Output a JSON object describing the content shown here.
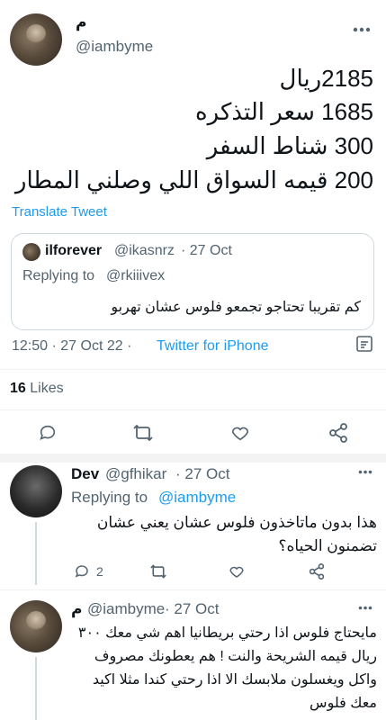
{
  "main_tweet": {
    "author_name": "م",
    "handle": "@iambyme",
    "lines": [
      "2185ريال",
      "1685 سعر التذكره",
      "300 شناط السفر",
      "200 قيمه السواق اللي وصلني المطار"
    ],
    "translate_label": "Translate Tweet",
    "quoted": {
      "name": "ilforever",
      "handle": "@ikasnrz",
      "date": "· 27 Oct",
      "replying_label": "Replying to",
      "replying_handle": "@rkiiivex",
      "text": "كم تقريبا تحتاجو تجمعو فلوس عشان تهربو"
    },
    "timestamp": "12:50 · 27 Oct 22 ·",
    "source": "Twitter for iPhone",
    "likes_count": "16",
    "likes_label": "Likes"
  },
  "replies": [
    {
      "name": "Dev",
      "handle": "@gfhikar",
      "date": "· 27 Oct",
      "replying_label": "Replying to",
      "replying_handle": "@iambyme",
      "text_lines": [
        "هذا بدون ماتاخذون فلوس عشان يعني عشان",
        "تضمنون الحياه؟"
      ],
      "reply_count": "2"
    },
    {
      "name": "م",
      "handle": "@iambyme",
      "date": "· 27 Oct",
      "text_lines": [
        "مايحتاج فلوس اذا رحتي بريطانيا اهم شي معك ٣٠٠",
        "ريال قيمه الشريحة والنت ! هم يعطونك مصروف",
        "واكل ويغسلون ملابسك الا اذا رحتي كندا مثلا اكيد",
        "معك فلوس"
      ]
    }
  ],
  "icons": {
    "reply": "reply-icon",
    "retweet": "retweet-icon",
    "like": "heart-icon",
    "share": "share-icon",
    "more": "more-icon",
    "analytics": "analytics-icon"
  },
  "colors": {
    "accent": "#1d9bf0",
    "secondary_text": "#536471",
    "text": "#0f1419"
  }
}
